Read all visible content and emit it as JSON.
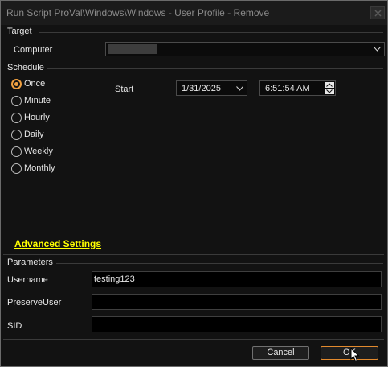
{
  "window": {
    "title": "Run Script ProVal\\Windows\\Windows - User Profile - Remove"
  },
  "icons": {
    "close": "close-icon",
    "chevron": "chevron-down-icon",
    "spin": "spin-up-down-icon",
    "cursor": "mouse-pointer-icon"
  },
  "target": {
    "section": "Target",
    "computer_label": "Computer",
    "computer_value": ""
  },
  "schedule": {
    "section": "Schedule",
    "options": [
      "Once",
      "Minute",
      "Hourly",
      "Daily",
      "Weekly",
      "Monthly"
    ],
    "selected": "Once",
    "start_label": "Start",
    "start_date": "1/31/2025",
    "start_time": "6:51:54 AM"
  },
  "advanced_settings": "Advanced Settings",
  "parameters": {
    "section": "Parameters",
    "fields": [
      {
        "label": "Username",
        "value": "testing123"
      },
      {
        "label": "PreserveUser",
        "value": ""
      },
      {
        "label": "SID",
        "value": ""
      }
    ]
  },
  "buttons": {
    "cancel": "Cancel",
    "ok": "OK"
  },
  "colors": {
    "accent": "#f0a040",
    "link": "#ffff00",
    "background": "#121212"
  }
}
